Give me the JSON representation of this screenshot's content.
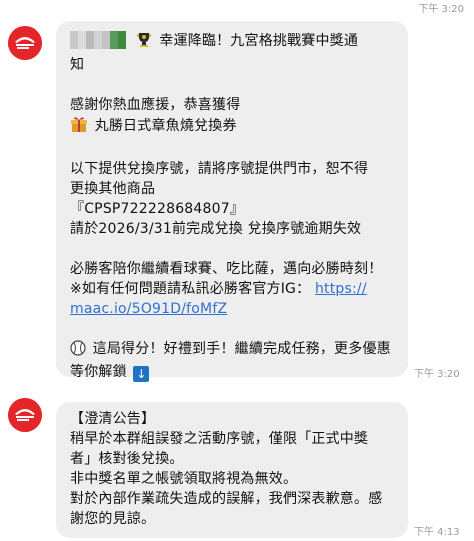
{
  "header": {
    "prev_time": "下午 3:20"
  },
  "messages": [
    {
      "sender": "Pizza Hut",
      "time": "下午 3:20",
      "lines": {
        "l1": "幸運降臨！九宮格挑戰賽中獎通",
        "l2": "知",
        "l3": "感謝你熱血應援，恭喜獲得",
        "l4": "丸勝日式章魚燒兌換券",
        "l5": "以下提供兌換序號，請將序號提供門市，恕不得",
        "l6": "更換其他商品",
        "l7": "『CPSP722228684807』",
        "l8": "請於2026/3/31前完成兌換 兌換序號逾期失效",
        "l9": "必勝客陪你繼續看球賽、吃比薩，邁向必勝時刻！",
        "l10a": "※如有任何問題請私訊必勝客官方IG：",
        "l10b": "https://",
        "l11": "maac.io/5O91D/foMfZ",
        "l12": "這局得分！好禮到手！繼續完成任務，更多優惠",
        "l13": "等你解鎖"
      },
      "icons": [
        "censored-name-icon",
        "trophy-icon",
        "gift-icon",
        "baseball-icon",
        "down-arrow-icon"
      ]
    },
    {
      "sender": "Pizza Hut",
      "time": "下午 4:13",
      "lines": {
        "l1": "【澄清公告】",
        "l2": "稍早於本群組誤發之活動序號，僅限「正式中獎",
        "l3": "者」核對後兌換。",
        "l4": "非中獎名單之帳號領取將視為無效。",
        "l5": "對於內部作業疏失造成的誤解，我們深表歉意。感",
        "l6": "謝您的見諒。"
      }
    }
  ],
  "colors": {
    "bubble": "#eeeeee",
    "brand": "#e4262b",
    "link": "#2f6fd0"
  }
}
